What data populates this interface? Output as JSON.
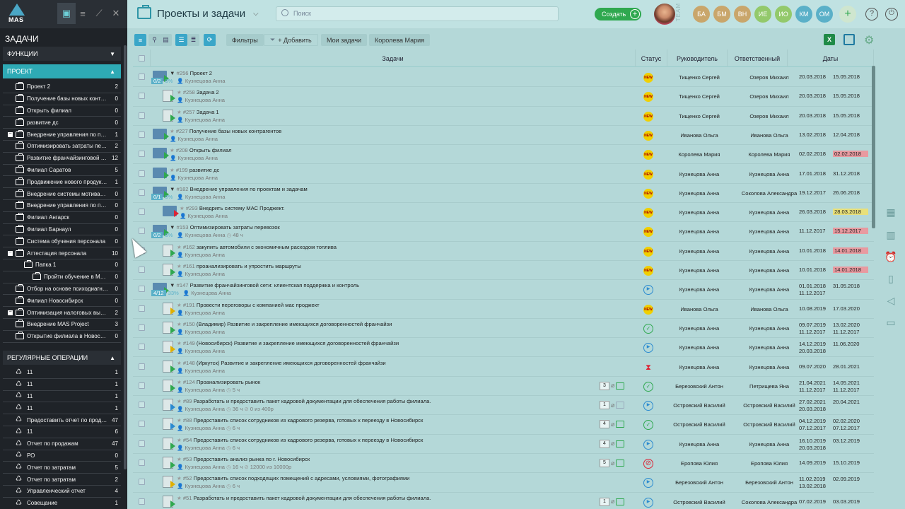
{
  "sidebar": {
    "logo": "MAS",
    "title": "ЗАДАЧИ",
    "functions": "ФУНКЦИИ",
    "project": "ПРОЕКТ",
    "regular": "РЕГУЛЯРНЫЕ ОПЕРАЦИИ",
    "projects": [
      {
        "label": "Проект 2",
        "count": "2",
        "lvl": 1,
        "exp": false
      },
      {
        "label": "Получение базы новых контраге...",
        "count": "0",
        "lvl": 1,
        "exp": false
      },
      {
        "label": "Открыть филиал",
        "count": "0",
        "lvl": 1,
        "exp": false
      },
      {
        "label": "развитие дс",
        "count": "0",
        "lvl": 1,
        "exp": false
      },
      {
        "label": "Внедрение управления по прое...",
        "count": "1",
        "lvl": 1,
        "exp": true
      },
      {
        "label": "Оптимизировать затраты перев...",
        "count": "2",
        "lvl": 1,
        "exp": false
      },
      {
        "label": "Развитие франчайзинговой сет...",
        "count": "12",
        "lvl": 1,
        "exp": false
      },
      {
        "label": "Филиал Саратов",
        "count": "5",
        "lvl": 1,
        "exp": false
      },
      {
        "label": "Продвижение нового продукта ...",
        "count": "1",
        "lvl": 1,
        "exp": false
      },
      {
        "label": "Внедрение системы мотивации ...",
        "count": "0",
        "lvl": 1,
        "exp": false
      },
      {
        "label": "Внедрение управления по прое...",
        "count": "0",
        "lvl": 1,
        "exp": false
      },
      {
        "label": "Филиал Ангарск",
        "count": "0",
        "lvl": 1,
        "exp": false
      },
      {
        "label": "Филиал Барнаул",
        "count": "0",
        "lvl": 1,
        "exp": false
      },
      {
        "label": "Система обучения персонала",
        "count": "0",
        "lvl": 1,
        "exp": false
      },
      {
        "label": "Аттестация персонала",
        "count": "10",
        "lvl": 1,
        "exp": true
      },
      {
        "label": "Папка 1",
        "count": "0",
        "lvl": 2,
        "exp": false
      },
      {
        "label": "Пройти обучение в Mass pro...",
        "count": "0",
        "lvl": 3,
        "exp": false
      },
      {
        "label": "Отбор на основе психодиагност...",
        "count": "0",
        "lvl": 1,
        "exp": false
      },
      {
        "label": "Филиал Новосибирск",
        "count": "0",
        "lvl": 1,
        "exp": false
      },
      {
        "label": "Оптимизация налоговых выплат",
        "count": "2",
        "lvl": 1,
        "exp": true
      },
      {
        "label": "Внедрение MAS Project",
        "count": "3",
        "lvl": 1,
        "exp": false
      },
      {
        "label": "Открытие филиала в Новосибир...",
        "count": "0",
        "lvl": 1,
        "exp": false
      }
    ],
    "regular_items": [
      {
        "label": "11",
        "count": "1"
      },
      {
        "label": "11",
        "count": "1"
      },
      {
        "label": "11",
        "count": "1"
      },
      {
        "label": "11",
        "count": "1"
      },
      {
        "label": "Предоставить отчет по продаж...",
        "count": "47"
      },
      {
        "label": "11",
        "count": "6"
      },
      {
        "label": "Отчет по продажам",
        "count": "47"
      },
      {
        "label": "РО",
        "count": "0"
      },
      {
        "label": "Отчет по затратам",
        "count": "5"
      },
      {
        "label": "Отчет по затратам",
        "count": "2"
      },
      {
        "label": "Управленческий отчет",
        "count": "4"
      },
      {
        "label": "Совещание",
        "count": "1"
      }
    ]
  },
  "header": {
    "title": "Проекты и задачи",
    "search_placeholder": "Поиск",
    "create": "Создать",
    "team": "TEAM",
    "avatars": [
      {
        "initials": "БА",
        "color": "#c9a66b"
      },
      {
        "initials": "БМ",
        "color": "#c9a66b"
      },
      {
        "initials": "ВН",
        "color": "#c9a66b"
      },
      {
        "initials": "ИЕ",
        "color": "#93c96b"
      },
      {
        "initials": "ИО",
        "color": "#93c96b"
      },
      {
        "initials": "КМ",
        "color": "#5ab0c8"
      },
      {
        "initials": "ОМ",
        "color": "#5ab0c8"
      }
    ]
  },
  "toolbar": {
    "filters": "Фильтры",
    "add": "+ Добавить",
    "my_tasks": "Мои задачи",
    "user": "Королева Мария"
  },
  "table": {
    "headers": {
      "tasks": "Задачи",
      "status": "Статус",
      "manager": "Руководитель",
      "responsible": "Ответственный",
      "dates": "Даты"
    },
    "rows": [
      {
        "indent": 0,
        "type": "folder",
        "expanded": true,
        "num": "#256",
        "name": "Проект 2",
        "prog": "0/2",
        "pct": "0%",
        "user": "Кузнецова Анна",
        "extra_sub": "",
        "status": "new",
        "mgr": "Тищенко Сергей",
        "resp": "Озеров Михаил",
        "d1": "20.03.2018",
        "d2": "15.05.2018",
        "d1b": "",
        "d2b": "",
        "hl": ""
      },
      {
        "indent": 1,
        "type": "doc",
        "num": "#258",
        "name": "Задача 2",
        "user": "Кузнецова Анна",
        "status": "new",
        "mgr": "Тищенко Сергей",
        "resp": "Озеров Михаил",
        "d1": "20.03.2018",
        "d2": "15.05.2018",
        "d1b": "",
        "d2b": "",
        "hl": ""
      },
      {
        "indent": 1,
        "type": "doc",
        "num": "#257",
        "name": "Задача 1",
        "user": "Кузнецова Анна",
        "status": "new",
        "mgr": "Тищенко Сергей",
        "resp": "Озеров Михаил",
        "d1": "20.03.2018",
        "d2": "15.05.2018",
        "d1b": "",
        "d2b": "",
        "hl": ""
      },
      {
        "indent": 0,
        "type": "folder",
        "num": "#227",
        "name": "Получение базы новых контрагентов",
        "user": "Кузнецова Анна",
        "status": "new",
        "mgr": "Иванова Ольга",
        "resp": "Иванова Ольга",
        "d1": "13.02.2018",
        "d2": "12.04.2018",
        "d1b": "",
        "d2b": "",
        "hl": ""
      },
      {
        "indent": 0,
        "type": "folder",
        "num": "#208",
        "name": "Открыть филиал",
        "user": "Кузнецова Анна",
        "status": "new",
        "mgr": "Королева Мария",
        "resp": "Королева Мария",
        "d1": "02.02.2018",
        "d2": "02.02.2018",
        "d1b": "",
        "d2b": "",
        "hl": "red"
      },
      {
        "indent": 0,
        "type": "folder",
        "num": "#199",
        "name": "развитие дс",
        "user": "Кузнецова Анна",
        "status": "new",
        "mgr": "Кузнецова Анна",
        "resp": "Кузнецова Анна",
        "d1": "17.01.2018",
        "d2": "31.12.2018",
        "d1b": "",
        "d2b": "",
        "hl": ""
      },
      {
        "indent": 0,
        "type": "folder",
        "expanded": true,
        "num": "#182",
        "name": "Внедрение управления по проектам и задачам",
        "prog": "0/1",
        "pct": "0%",
        "user": "Кузнецова Анна",
        "status": "new",
        "mgr": "Кузнецова Анна",
        "resp": "Соколова Александра",
        "d1": "19.12.2017",
        "d2": "26.06.2018",
        "d1b": "",
        "d2b": "",
        "hl": ""
      },
      {
        "indent": 1,
        "type": "folder",
        "red": true,
        "num": "#293",
        "name": "Внедрить систему МАС Проджект.",
        "user": "Кузнецова Анна",
        "status": "new",
        "mgr": "Кузнецова Анна",
        "resp": "Кузнецова Анна",
        "d1": "26.03.2018",
        "d2": "28.03.2018",
        "d1b": "",
        "d2b": "",
        "hl": "yel"
      },
      {
        "indent": 0,
        "type": "folder",
        "expanded": true,
        "num": "#153",
        "name": "Оптимизировать затраты перевозок",
        "prog": "0/2",
        "pct": "0%",
        "user": "Кузнецова Анна",
        "hours": "48 ч",
        "status": "new",
        "mgr": "Кузнецова Анна",
        "resp": "Кузнецова Анна",
        "d1": "11.12.2017",
        "d2": "15.12.2017",
        "d1b": "",
        "d2b": "",
        "hl": "red"
      },
      {
        "indent": 1,
        "type": "doc",
        "num": "#162",
        "name": "закупить автомобили с экономичным расходом топлива",
        "user": "Кузнецова Анна",
        "status": "new",
        "mgr": "Кузнецова Анна",
        "resp": "Кузнецова Анна",
        "d1": "10.01.2018",
        "d2": "14.01.2018",
        "d1b": "",
        "d2b": "",
        "hl": "red"
      },
      {
        "indent": 1,
        "type": "doc",
        "num": "#161",
        "name": "проанализировать и упростить маршруты",
        "user": "Кузнецова Анна",
        "status": "new",
        "mgr": "Кузнецова Анна",
        "resp": "Кузнецова Анна",
        "d1": "10.01.2018",
        "d2": "14.01.2018",
        "d1b": "",
        "d2b": "",
        "hl": "red"
      },
      {
        "indent": 0,
        "type": "folder",
        "expanded": true,
        "num": "#147",
        "name": "Развитие франчайзинговой сети: клиентская поддержка и контроль",
        "prog": "4/12",
        "pct": "33%",
        "user": "Кузнецова Анна",
        "status": "play",
        "mgr": "Кузнецова Анна",
        "resp": "Кузнецова Анна",
        "d1": "01.01.2018",
        "d2": "31.05.2018",
        "d1b": "11.12.2017",
        "d2b": "",
        "hl": ""
      },
      {
        "indent": 1,
        "type": "doc",
        "variant": "yel",
        "num": "#191",
        "name": "Провести переговоры с компанией мас проджект",
        "user": "Кузнецова Анна",
        "status": "new",
        "mgr": "Иванова Ольга",
        "resp": "Иванова Ольга",
        "d1": "10.08.2019",
        "d2": "17.03.2020",
        "d1b": "",
        "d2b": "",
        "hl": ""
      },
      {
        "indent": 1,
        "type": "doc",
        "num": "#150",
        "name": "(Владимир) Развитие и закрепление имеющихся договоренностей франчайзи",
        "user": "Кузнецова Анна",
        "status": "ok",
        "mgr": "Кузнецова Анна",
        "resp": "Кузнецова Анна",
        "d1": "09.07.2019",
        "d2": "13.02.2020",
        "d1b": "11.12.2017",
        "d2b": "11.12.2017",
        "hl": ""
      },
      {
        "indent": 1,
        "type": "doc",
        "variant": "yel",
        "num": "#149",
        "name": "(Новосибирск) Развитие и закрепление имеющихся договоренностей франчайзи",
        "user": "Кузнецова Анна",
        "status": "play",
        "mgr": "Кузнецова Анна",
        "resp": "Кузнецова Анна",
        "d1": "14.12.2019",
        "d2": "11.06.2020",
        "d1b": "20.03.2018",
        "d2b": "",
        "hl": ""
      },
      {
        "indent": 1,
        "type": "doc",
        "num": "#148",
        "name": "(Иркутск) Развитие и закрепление имеющихся договоренностей франчайзи",
        "user": "Кузнецова Анна",
        "status": "hg",
        "mgr": "Кузнецова Анна",
        "resp": "Кузнецова Анна",
        "d1": "09.07.2020",
        "d2": "28.01.2021",
        "d1b": "",
        "d2b": "",
        "hl": ""
      },
      {
        "indent": 1,
        "type": "doc",
        "num": "#124",
        "name": "Проанализировать рынок",
        "user": "Кузнецова Анна",
        "hours": "5 ч",
        "cnt": "3",
        "chat": true,
        "status": "ok",
        "mgr": "Березовский Антон",
        "resp": "Петрищева Яна",
        "d1": "21.04.2021",
        "d2": "14.05.2021",
        "d1b": "11.12.2017",
        "d2b": "11.12.2017",
        "hl": ""
      },
      {
        "indent": 1,
        "type": "doc",
        "variant": "blu",
        "num": "#89",
        "name": "Разработать и предоставить пакет кадровой документации для обеспечения работы филиала.",
        "user": "Кузнецова Анна",
        "hours": "36 ч",
        "budget": "0 из 400р",
        "cnt": "1",
        "chat": false,
        "status": "play",
        "mgr": "Островский Василий",
        "resp": "Островский Василий",
        "d1": "27.02.2021",
        "d2": "20.04.2021",
        "d1b": "20.03.2018",
        "d2b": "",
        "hl": ""
      },
      {
        "indent": 1,
        "type": "doc",
        "variant": "blu",
        "num": "#88",
        "name": "Предоставить список сотрудников из кадрового резерва, готовых к переезду в Новосибирск",
        "user": "Кузнецова Анна",
        "hours": "6 ч",
        "cnt": "4",
        "chat": true,
        "status": "ok",
        "mgr": "Островский Василий",
        "resp": "Островский Василий",
        "d1": "04.12.2019",
        "d2": "02.02.2020",
        "d1b": "07.12.2017",
        "d2b": "07.12.2017",
        "hl": ""
      },
      {
        "indent": 1,
        "type": "doc",
        "num": "#54",
        "name": "Предоставить список сотрудников из кадрового резерва, готовых к переезду в Новосибирск",
        "user": "Кузнецова Анна",
        "hours": "6 ч",
        "cnt": "4",
        "chat": true,
        "status": "play",
        "mgr": "Кузнецова Анна",
        "resp": "Кузнецова Анна",
        "d1": "16.10.2019",
        "d2": "03.12.2019",
        "d1b": "20.03.2018",
        "d2b": "",
        "hl": ""
      },
      {
        "indent": 1,
        "type": "doc",
        "num": "#53",
        "name": "Предоставить анализ рынка по г. Новосибирск",
        "user": "Кузнецова Анна",
        "hours": "16 ч",
        "budget": "12000 из 10000р",
        "cnt": "5",
        "chat": true,
        "status": "no",
        "mgr": "Еропова Юлия",
        "resp": "Еропова Юлия",
        "d1": "14.09.2019",
        "d2": "15.10.2019",
        "d1b": "",
        "d2b": "",
        "hl": ""
      },
      {
        "indent": 1,
        "type": "doc",
        "variant": "yel",
        "num": "#52",
        "name": "Предоставить список подходящих помещений с адресами, условиями, фотографиями",
        "user": "Кузнецова Анна",
        "hours": "6 ч",
        "status": "play",
        "mgr": "Березовский Антон",
        "resp": "Березовский Антон",
        "d1": "11.02.2019",
        "d2": "02.09.2019",
        "d1b": "13.02.2018",
        "d2b": "",
        "hl": ""
      },
      {
        "indent": 1,
        "type": "doc",
        "num": "#51",
        "name": "Разработать и предоставить пакет кадровой документации для обеспечения работы филиала.",
        "user": "",
        "cnt": "1",
        "chat": true,
        "status": "play",
        "mgr": "Островский Василий",
        "resp": "Соколова Александра",
        "d1": "07.02.2019",
        "d2": "03.03.2019",
        "d1b": "",
        "d2b": "",
        "hl": ""
      }
    ]
  }
}
